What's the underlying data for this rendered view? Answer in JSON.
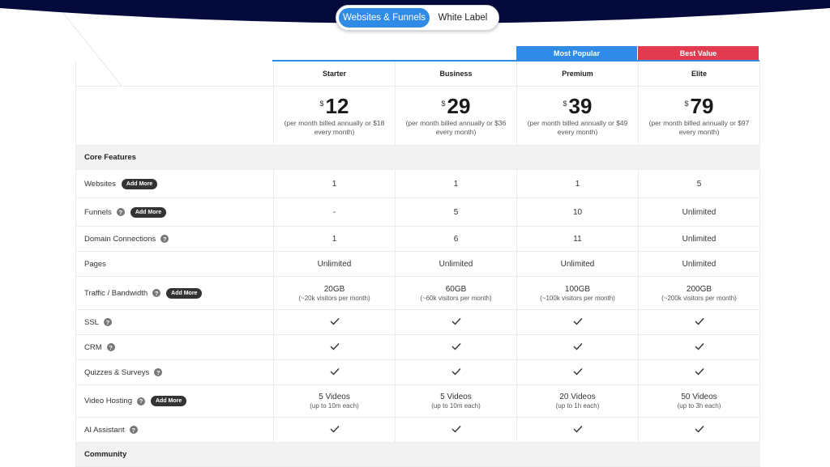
{
  "toggle": {
    "active": "Websites & Funnels",
    "inactive": "White Label"
  },
  "badges": {
    "premium": "Most Popular",
    "elite": "Best Value"
  },
  "colors": {
    "accent": "#2f8be6",
    "best_value": "#e23b4f",
    "hero": "#050a3c"
  },
  "plans": [
    {
      "name": "Starter",
      "currency": "$",
      "price": "12",
      "note": "(per month billed annually or $18 every month)"
    },
    {
      "name": "Business",
      "currency": "$",
      "price": "29",
      "note": "(per month billed annually or $36 every month)"
    },
    {
      "name": "Premium",
      "currency": "$",
      "price": "39",
      "note": "(per month billed annually or $49 every month)"
    },
    {
      "name": "Elite",
      "currency": "$",
      "price": "79",
      "note": "(per month billed annually or $97 every month)"
    }
  ],
  "add_more_label": "Add More",
  "help_label": "?",
  "sections": {
    "core": "Core Features",
    "community": "Community"
  },
  "features": [
    {
      "label": "Websites",
      "values": [
        "1",
        "1",
        "1",
        "5"
      ]
    },
    {
      "label": "Funnels",
      "values": [
        "-",
        "5",
        "10",
        "Unlimited"
      ]
    },
    {
      "label": "Domain Connections",
      "values": [
        "1",
        "6",
        "11",
        "Unlimited"
      ]
    },
    {
      "label": "Pages",
      "values": [
        "Unlimited",
        "Unlimited",
        "Unlimited",
        "Unlimited"
      ]
    },
    {
      "label": "Traffic / Bandwidth",
      "values": [
        "20GB",
        "60GB",
        "100GB",
        "200GB"
      ],
      "subs": [
        "(~20k visitors per month)",
        "(~60k visitors per month)",
        "(~100k visitors per month)",
        "(~200k visitors per month)"
      ]
    },
    {
      "label": "SSL",
      "check": true
    },
    {
      "label": "CRM",
      "check": true
    },
    {
      "label": "Quizzes & Surveys",
      "check": true
    },
    {
      "label": "Video Hosting",
      "values": [
        "5 Videos",
        "5 Videos",
        "20 Videos",
        "50 Videos"
      ],
      "subs": [
        "(up to 10m each)",
        "(up to 10m each)",
        "(up to 1h each)",
        "(up to 3h each)"
      ]
    },
    {
      "label": "AI Assistant",
      "check": true
    }
  ]
}
